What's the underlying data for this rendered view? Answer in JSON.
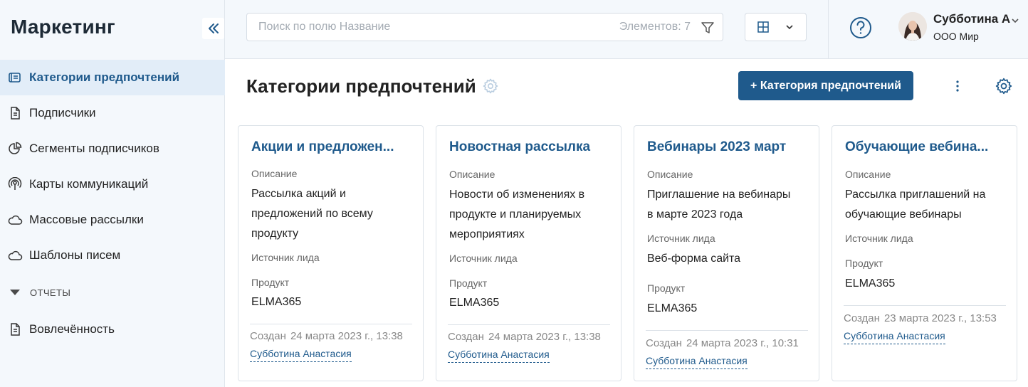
{
  "sidebar": {
    "app_title": "Маркетинг",
    "items": [
      {
        "label": "Категории предпочтений",
        "icon": "categories-icon"
      },
      {
        "label": "Подписчики",
        "icon": "document-icon"
      },
      {
        "label": "Сегменты подписчиков",
        "icon": "pie-chart-icon"
      },
      {
        "label": "Карты коммуникаций",
        "icon": "broadcast-icon"
      },
      {
        "label": "Массовые рассылки",
        "icon": "cloud-icon"
      },
      {
        "label": "Шаблоны писем",
        "icon": "cloud-icon"
      }
    ],
    "group_label": "ОТЧЕТЫ",
    "reports": [
      {
        "label": "Вовлечённость",
        "icon": "document-icon"
      }
    ]
  },
  "topbar": {
    "search_placeholder": "Поиск по полю Название",
    "count_text": "Элементов: 7",
    "user_name": "Субботина А",
    "user_org": "ООО Мир"
  },
  "page": {
    "title": "Категории предпочтений",
    "add_button": "+ Категория предпочтений"
  },
  "labels": {
    "description": "Описание",
    "lead_source": "Источник лида",
    "product": "Продукт",
    "created": "Создан"
  },
  "cards": [
    {
      "title": "Акции и предложен...",
      "description": "Рассылка акций и предложений по всему продукту",
      "lead_source": "",
      "product": "ELMA365",
      "created_date": "24 марта 2023 г., 13:38",
      "author": "Субботина Анастасия"
    },
    {
      "title": "Новостная рассылка",
      "description": "Новости об изменениях в продукте и планируемых мероприятиях",
      "lead_source": "",
      "product": "ELMA365",
      "created_date": "24 марта 2023 г., 13:38",
      "author": "Субботина Анастасия"
    },
    {
      "title": "Вебинары 2023 март",
      "description": "Приглашение на вебинары в марте 2023 года",
      "lead_source": "Веб-форма сайта",
      "product": "ELMA365",
      "created_date": "24 марта 2023 г., 10:31",
      "author": "Субботина Анастасия"
    },
    {
      "title": "Обучающие вебина...",
      "description": "Рассылка приглашений на обучающие вебинары",
      "lead_source": "",
      "product": "ELMA365",
      "created_date": "23 марта 2023 г., 13:53",
      "author": "Субботина Анастасия"
    }
  ],
  "colors": {
    "accent": "#1f5a8c",
    "sidebar_bg": "#f4f8fc",
    "active_bg": "#e2edf8"
  }
}
